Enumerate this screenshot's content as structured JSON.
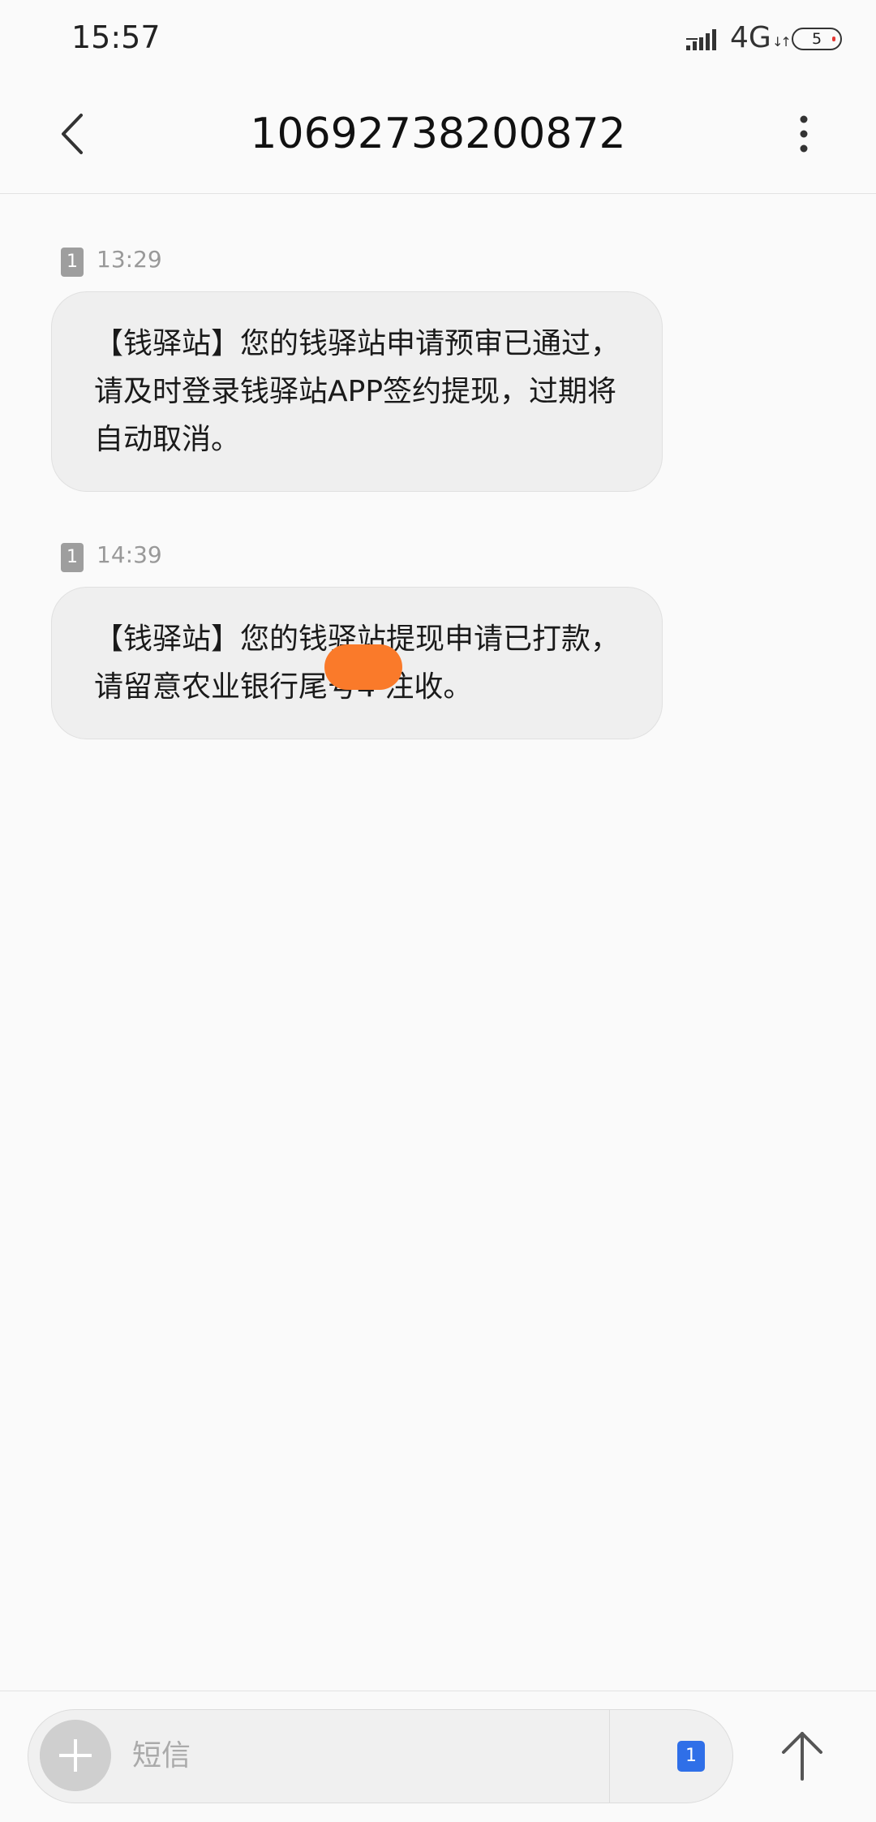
{
  "status_bar": {
    "time": "15:57",
    "network": "4G",
    "network_arrows": "↓↑",
    "battery": "5",
    "signal_icon": "signal-bars-icon"
  },
  "header": {
    "title": "10692738200872",
    "back_icon": "chevron-left-icon",
    "more_icon": "more-vertical-icon"
  },
  "messages": [
    {
      "sim": "1",
      "time": "13:29",
      "text": "【钱驿站】您的钱驿站申请预审已通过，请及时登录钱驿站APP签约提现，过期将自动取消。"
    },
    {
      "sim": "1",
      "time": "14:39",
      "text": "【钱驿站】您的钱驿站提现申请已打款，请留意农业银行尾号4 注收。"
    }
  ],
  "composer": {
    "placeholder": "短信",
    "sim_label": "1",
    "add_icon": "plus-icon",
    "send_icon": "arrow-up-icon"
  },
  "colors": {
    "background": "#fafafa",
    "bubble": "#efefef",
    "sim_active": "#2f6fe8",
    "redaction": "#fa7a2a"
  }
}
